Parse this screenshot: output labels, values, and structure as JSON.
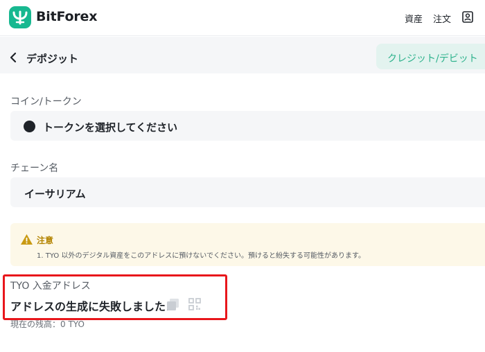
{
  "header": {
    "brand": "BitForex",
    "nav": {
      "assets": "資産",
      "orders": "注文"
    },
    "brand_color": "#17b890"
  },
  "subbar": {
    "title": "デポジット",
    "credit_tab": "クレジット/デビット"
  },
  "form": {
    "coin_label": "コイン/トークン",
    "coin_value": "トークンを選択してください",
    "chain_label": "チェーン名",
    "chain_value": "イーサリアム"
  },
  "notice": {
    "title": "注意",
    "body": "1. TYO 以外のデジタル資産をこのアドレスに預けないでください。預けると紛失する可能性があります。",
    "accent_color": "#b38300"
  },
  "deposit": {
    "address_label": "TYO 入金アドレス",
    "address_value": "アドレスの生成に失敗しました!",
    "balance": "現在の残高：0 TYO"
  },
  "highlight_color": "#e8161b"
}
